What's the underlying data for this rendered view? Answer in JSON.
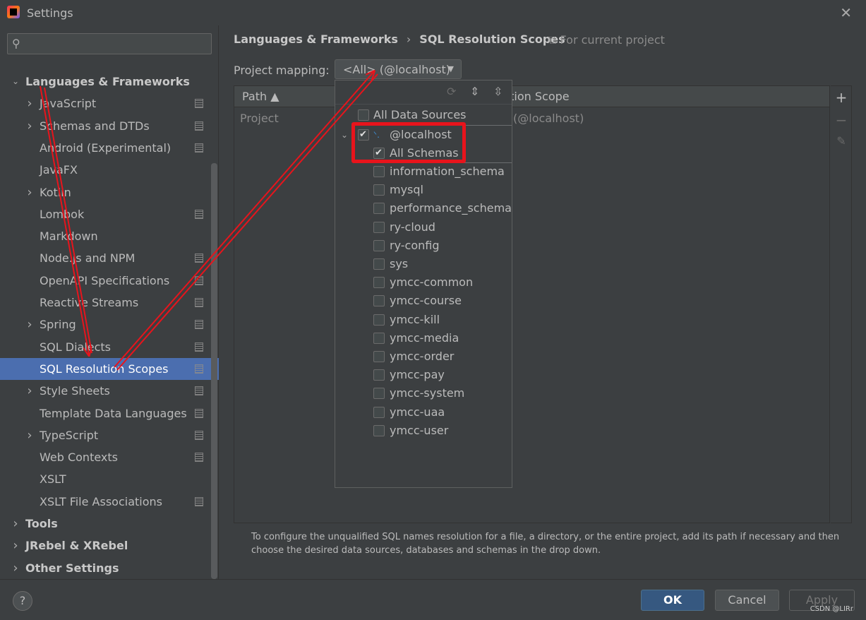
{
  "window": {
    "title": "Settings",
    "close_glyph": "✕"
  },
  "sidebar": {
    "search_placeholder": "",
    "nodes": [
      {
        "label": "Languages & Frameworks",
        "bold": true,
        "expanded": true,
        "has_arrow": true,
        "config": false
      },
      {
        "label": "JavaScript",
        "has_arrow": true,
        "config": true
      },
      {
        "label": "Schemas and DTDs",
        "has_arrow": true,
        "config": true
      },
      {
        "label": "Android (Experimental)",
        "has_arrow": false,
        "config": true
      },
      {
        "label": "JavaFX",
        "has_arrow": false,
        "config": false
      },
      {
        "label": "Kotlin",
        "has_arrow": true,
        "config": false
      },
      {
        "label": "Lombok",
        "has_arrow": false,
        "config": true
      },
      {
        "label": "Markdown",
        "has_arrow": false,
        "config": false
      },
      {
        "label": "Node.js and NPM",
        "has_arrow": false,
        "config": true
      },
      {
        "label": "OpenAPI Specifications",
        "has_arrow": false,
        "config": true
      },
      {
        "label": "Reactive Streams",
        "has_arrow": false,
        "config": true
      },
      {
        "label": "Spring",
        "has_arrow": true,
        "config": true
      },
      {
        "label": "SQL Dialects",
        "has_arrow": false,
        "config": true
      },
      {
        "label": "SQL Resolution Scopes",
        "has_arrow": false,
        "config": true,
        "selected": true
      },
      {
        "label": "Style Sheets",
        "has_arrow": true,
        "config": true
      },
      {
        "label": "Template Data Languages",
        "has_arrow": false,
        "config": true
      },
      {
        "label": "TypeScript",
        "has_arrow": true,
        "config": true
      },
      {
        "label": "Web Contexts",
        "has_arrow": false,
        "config": true
      },
      {
        "label": "XSLT",
        "has_arrow": false,
        "config": false
      },
      {
        "label": "XSLT File Associations",
        "has_arrow": false,
        "config": true
      },
      {
        "label": "Tools",
        "bold": true,
        "has_arrow": true,
        "top_level": true
      },
      {
        "label": "JRebel & XRebel",
        "bold": true,
        "has_arrow": true,
        "top_level": true
      },
      {
        "label": "Other Settings",
        "bold": true,
        "has_arrow": true,
        "top_level": true
      }
    ]
  },
  "main": {
    "breadcrumb_parent": "Languages & Frameworks",
    "breadcrumb_sep": "›",
    "breadcrumb_current": "SQL Resolution Scopes",
    "scope_note": "For current project",
    "project_mapping_label": "Project mapping:",
    "project_mapping_value": "<All> (@localhost)",
    "table": {
      "col_path": "Path ▲",
      "col_scope": "ution Scope",
      "row_path": "Project",
      "row_scope": "(@localhost)"
    },
    "hint": "To configure the unqualified SQL names resolution for a file, a directory, or the entire project, add its path if necessary and then choose the desired data sources, databases and schemas in the drop down."
  },
  "popup": {
    "all_data_sources": "All Data Sources",
    "datasource": "@localhost",
    "all_schemas": "All Schemas",
    "schemas": [
      "information_schema",
      "mysql",
      "performance_schema",
      "ry-cloud",
      "ry-config",
      "sys",
      "ymcc-common",
      "ymcc-course",
      "ymcc-kill",
      "ymcc-media",
      "ymcc-order",
      "ymcc-pay",
      "ymcc-system",
      "ymcc-uaa",
      "ymcc-user"
    ]
  },
  "footer": {
    "help": "?",
    "ok": "OK",
    "cancel": "Cancel",
    "apply": "Apply",
    "watermark": "CSDN @LIRr"
  },
  "colors": {
    "selection": "#4b6eaf",
    "annotation_red": "#e8141c",
    "ok_button": "#365880"
  }
}
